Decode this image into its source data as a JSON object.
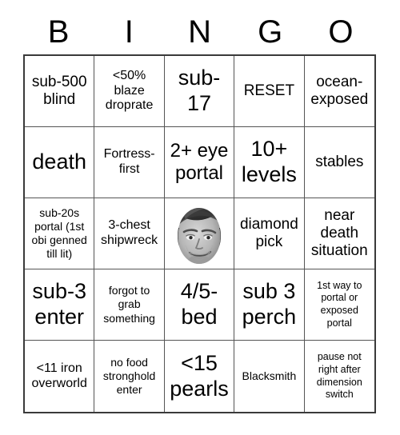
{
  "header": {
    "letters": [
      "B",
      "I",
      "N",
      "G",
      "O"
    ]
  },
  "grid": {
    "rows": 5,
    "columns": 5,
    "border_color": "#3a3a3a",
    "line_color": "#555555",
    "background": "#ffffff",
    "text_color": "#000000"
  },
  "cells": [
    {
      "text": "sub-500 blind",
      "size": "md",
      "name": "cell-b1"
    },
    {
      "text": "<50% blaze droprate",
      "size": "sm",
      "name": "cell-i1"
    },
    {
      "text": "sub-17",
      "size": "xl",
      "name": "cell-n1"
    },
    {
      "text": "RESET",
      "size": "md",
      "name": "cell-g1"
    },
    {
      "text": "ocean-exposed",
      "size": "md",
      "name": "cell-o1"
    },
    {
      "text": "death",
      "size": "xl",
      "name": "cell-b2"
    },
    {
      "text": "Fortress-first",
      "size": "sm",
      "name": "cell-i2"
    },
    {
      "text": "2+ eye portal",
      "size": "lg",
      "name": "cell-n2"
    },
    {
      "text": "10+ levels",
      "size": "xl",
      "name": "cell-g2"
    },
    {
      "text": "stables",
      "size": "md",
      "name": "cell-o2"
    },
    {
      "text": "sub-20s portal (1st obi genned till lit)",
      "size": "xs",
      "name": "cell-b3"
    },
    {
      "text": "3-chest shipwreck",
      "size": "sm",
      "name": "cell-i3"
    },
    {
      "text": "",
      "size": "md",
      "name": "cell-n3-free",
      "icon": "kappa-face-image",
      "free_space": true
    },
    {
      "text": "diamond pick",
      "size": "md",
      "name": "cell-g3"
    },
    {
      "text": "near death situation",
      "size": "md",
      "name": "cell-o3"
    },
    {
      "text": "sub-3 enter",
      "size": "xl",
      "name": "cell-b4"
    },
    {
      "text": "forgot to grab something",
      "size": "xs",
      "name": "cell-i4"
    },
    {
      "text": "4/5-bed",
      "size": "xl",
      "name": "cell-n4"
    },
    {
      "text": "sub 3 perch",
      "size": "xl",
      "name": "cell-g4"
    },
    {
      "text": "1st way to portal or exposed portal",
      "size": "xxs",
      "name": "cell-o4"
    },
    {
      "text": "<11 iron overworld",
      "size": "sm",
      "name": "cell-b5"
    },
    {
      "text": "no food stronghold enter",
      "size": "xs",
      "name": "cell-i5"
    },
    {
      "text": "<15 pearls",
      "size": "xl",
      "name": "cell-n5"
    },
    {
      "text": "Blacksmith",
      "size": "xs",
      "name": "cell-g5"
    },
    {
      "text": "pause not right after dimension switch",
      "size": "xxs",
      "name": "cell-o5"
    }
  ]
}
